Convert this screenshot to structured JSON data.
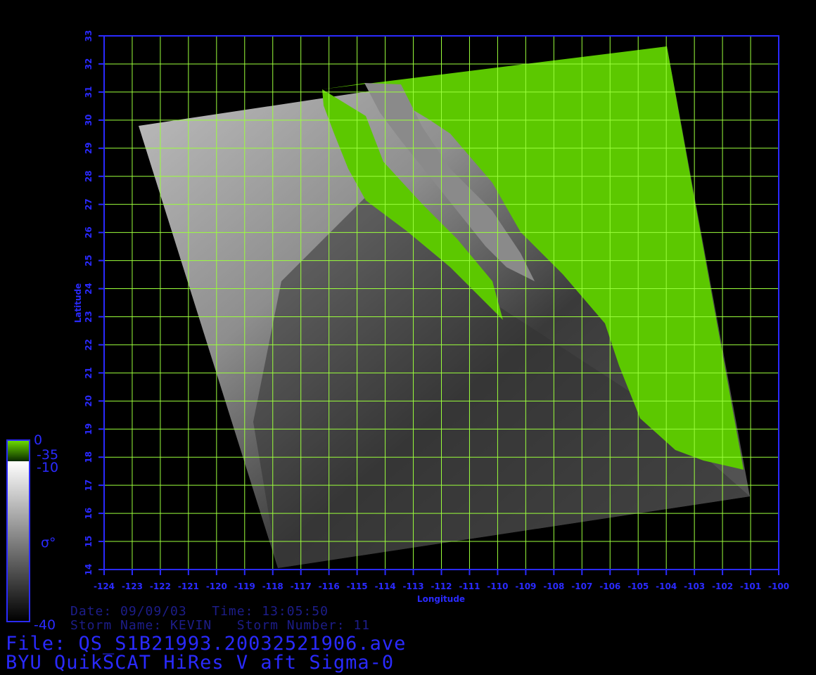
{
  "map": {
    "lon_range": [
      -124,
      -100
    ],
    "lat_range": [
      14,
      33
    ],
    "xlabel": "Longitude",
    "ylabel": "Latitude",
    "lon_ticks": [
      "-124",
      "-123",
      "-122",
      "-121",
      "-120",
      "-119",
      "-118",
      "-117",
      "-116",
      "-115",
      "-114",
      "-113",
      "-112",
      "-111",
      "-110",
      "-109",
      "-108",
      "-107",
      "-106",
      "-105",
      "-104",
      "-103",
      "-102",
      "-101",
      "-100"
    ],
    "lat_ticks": [
      "14",
      "15",
      "16",
      "17",
      "18",
      "19",
      "20",
      "21",
      "22",
      "23",
      "24",
      "25",
      "26",
      "27",
      "28",
      "29",
      "30",
      "31",
      "32",
      "33"
    ],
    "colors": {
      "grid": "#9bff3c",
      "frame": "#2a2aff",
      "land": "#5cc800",
      "ocean_light": "#b8b8b8",
      "ocean_dark": "#2a2a2a"
    }
  },
  "colorbar": {
    "label": "σ°",
    "land_max": "0",
    "land_min": "-35",
    "top": "-10",
    "bottom": "-40"
  },
  "info": {
    "date_line": "Date: 09/09/03   Time: 13:05:50",
    "storm_line": "Storm Name: KEVIN   Storm Number: 11",
    "file_line": "File: QS_S1B21993.20032521906.ave",
    "product_line": "BYU QuikSCAT HiRes V aft Sigma-0"
  }
}
